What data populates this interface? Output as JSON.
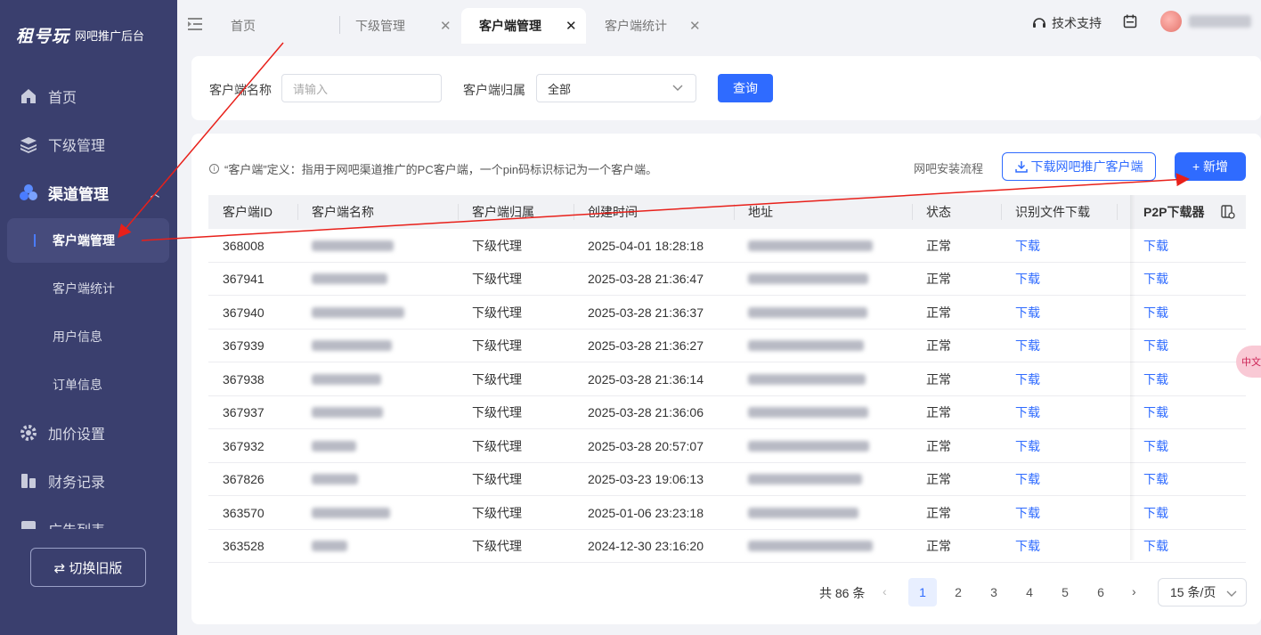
{
  "sidebar": {
    "logo_mark": "租号玩",
    "logo_sub": "网吧推广后台",
    "items": [
      {
        "label": "首页",
        "icon": "home-icon"
      },
      {
        "label": "下级管理",
        "icon": "layers-icon"
      },
      {
        "label": "渠道管理",
        "icon": "channel-icon"
      },
      {
        "label": "加价设置",
        "icon": "gear-icon"
      },
      {
        "label": "财务记录",
        "icon": "finance-icon"
      },
      {
        "label": "广告列表",
        "icon": "ad-icon"
      }
    ],
    "sub_items": [
      {
        "label": "客户端管理"
      },
      {
        "label": "客户端统计"
      },
      {
        "label": "用户信息"
      },
      {
        "label": "订单信息"
      }
    ],
    "switch_label": "⇄ 切换旧版"
  },
  "topbar": {
    "tabs": [
      {
        "label": "首页"
      },
      {
        "label": "下级管理"
      },
      {
        "label": "客户端管理"
      },
      {
        "label": "客户端统计"
      }
    ],
    "support_label": "技术支持"
  },
  "search": {
    "name_label": "客户端名称",
    "name_placeholder": "请输入",
    "owner_label": "客户端归属",
    "owner_value": "全部",
    "query_label": "查询"
  },
  "table_card": {
    "info_text": "“客户端”定义：指用于网吧渠道推广的PC客户端，一个pin码标识标记为一个客户端。",
    "install_flow_label": "网吧安装流程",
    "download_button_label": "下载网吧推广客户端",
    "add_button_label": "+ 新增",
    "columns": [
      "客户端ID",
      "客户端名称",
      "客户端归属",
      "创建时间",
      "地址",
      "状态",
      "识别文件下载",
      "P2P下载器"
    ],
    "rows": [
      {
        "id": "368008",
        "owner": "下级代理",
        "created": "2025-04-01 18:28:18",
        "status": "正常",
        "file": "下载",
        "p2p": "下载"
      },
      {
        "id": "367941",
        "owner": "下级代理",
        "created": "2025-03-28 21:36:47",
        "status": "正常",
        "file": "下载",
        "p2p": "下载"
      },
      {
        "id": "367940",
        "owner": "下级代理",
        "created": "2025-03-28 21:36:37",
        "status": "正常",
        "file": "下载",
        "p2p": "下载"
      },
      {
        "id": "367939",
        "owner": "下级代理",
        "created": "2025-03-28 21:36:27",
        "status": "正常",
        "file": "下载",
        "p2p": "下载"
      },
      {
        "id": "367938",
        "owner": "下级代理",
        "created": "2025-03-28 21:36:14",
        "status": "正常",
        "file": "下载",
        "p2p": "下载"
      },
      {
        "id": "367937",
        "owner": "下级代理",
        "created": "2025-03-28 21:36:06",
        "status": "正常",
        "file": "下载",
        "p2p": "下载"
      },
      {
        "id": "367932",
        "owner": "下级代理",
        "created": "2025-03-28 20:57:07",
        "status": "正常",
        "file": "下载",
        "p2p": "下载"
      },
      {
        "id": "367826",
        "owner": "下级代理",
        "created": "2025-03-23 19:06:13",
        "status": "正常",
        "file": "下载",
        "p2p": "下载"
      },
      {
        "id": "363570",
        "owner": "下级代理",
        "created": "2025-01-06 23:23:18",
        "status": "正常",
        "file": "下载",
        "p2p": "下载"
      },
      {
        "id": "363528",
        "owner": "下级代理",
        "created": "2024-12-30 23:16:20",
        "status": "正常",
        "file": "下载",
        "p2p": "下载"
      }
    ]
  },
  "pagination": {
    "total_label": "共 86 条",
    "pages": [
      "1",
      "2",
      "3",
      "4",
      "5",
      "6"
    ],
    "current_page": "1",
    "page_size": "15 条/页"
  },
  "float_badge": "中文",
  "colors": {
    "accent": "#2f6bff",
    "sidebar": "#3a3f6e",
    "annotation": "#e8201a"
  }
}
